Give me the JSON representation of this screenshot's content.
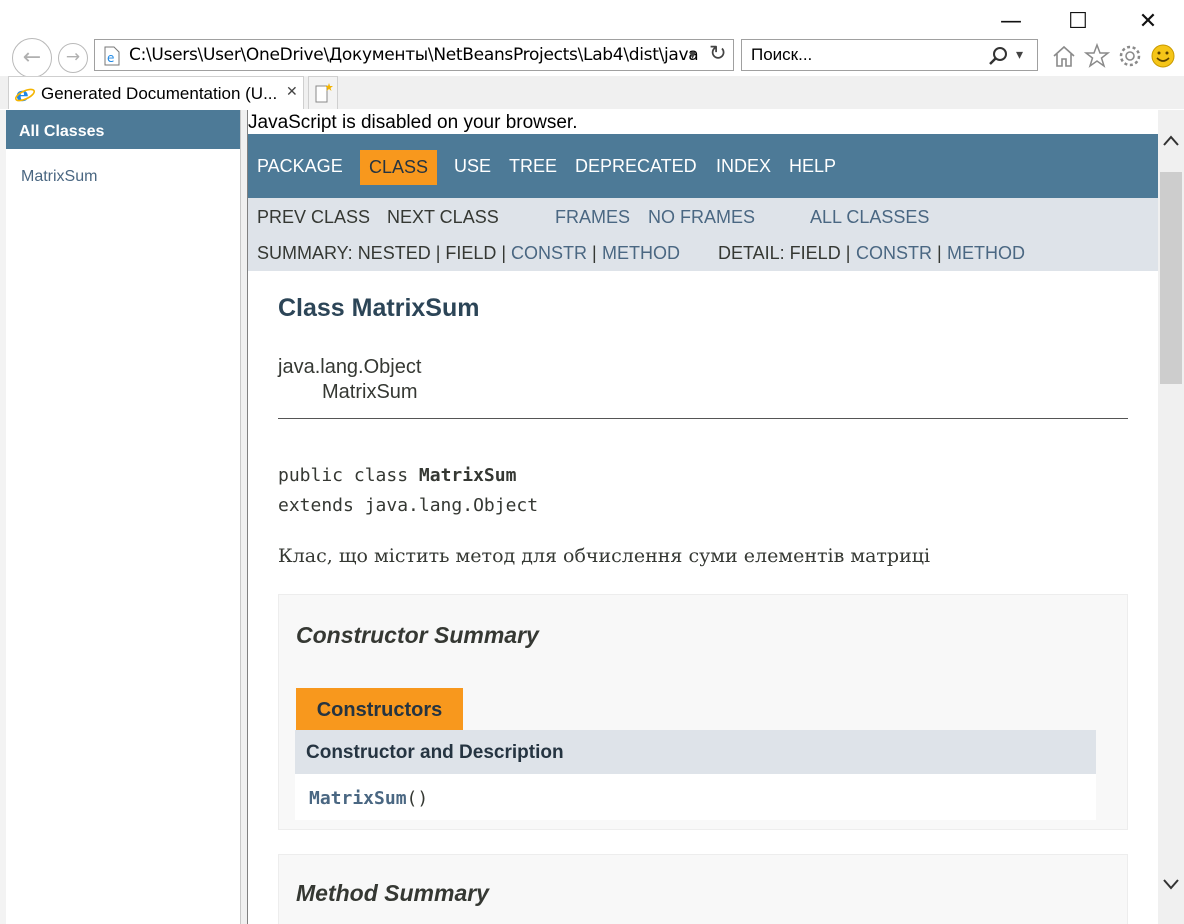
{
  "window": {
    "minimize": "—",
    "maximize": "☐",
    "close": "✕"
  },
  "toolbar": {
    "back": "←",
    "forward": "→",
    "address": "C:\\Users\\User\\OneDrive\\Документы\\NetBeansProjects\\Lab4\\dist\\java",
    "search_placeholder": "Поиск...",
    "refresh": "↻",
    "dropdown": "▾"
  },
  "tab": {
    "title": "Generated Documentation (U...",
    "close": "✕"
  },
  "left_frame": {
    "header": "All Classes",
    "classes": [
      "MatrixSum"
    ]
  },
  "content": {
    "noscript": "JavaScript is disabled on your browser.",
    "nav": {
      "items": [
        "PACKAGE",
        "CLASS",
        "USE",
        "TREE",
        "DEPRECATED",
        "INDEX",
        "HELP"
      ],
      "active": "CLASS"
    },
    "subnav": {
      "prev": "PREV CLASS",
      "next": "NEXT CLASS",
      "frames": "FRAMES",
      "no_frames": "NO FRAMES",
      "all_classes": "ALL CLASSES",
      "summary_label": "SUMMARY: NESTED | FIELD |",
      "constr": "CONSTR",
      "sep": "|",
      "method": "METHOD",
      "detail_label": "DETAIL: FIELD |"
    },
    "title": "Class MatrixSum",
    "inheritance": [
      "java.lang.Object",
      "MatrixSum"
    ],
    "signature": {
      "line1_prefix": "public class ",
      "line1_name": "MatrixSum",
      "line2": "extends java.lang.Object"
    },
    "description": "Клас, що містить метод для обчислення суми елементів матриці",
    "constructor_summary": {
      "heading": "Constructor Summary",
      "caption": "Constructors",
      "column": "Constructor and Description",
      "rows": [
        {
          "name": "MatrixSum",
          "params": "()"
        }
      ]
    },
    "method_summary": {
      "heading": "Method Summary"
    }
  },
  "colors": {
    "nav_bg": "#4d7a97",
    "active_bg": "#f8981d",
    "subnav_bg": "#dee3e9",
    "link": "#4a6782"
  }
}
